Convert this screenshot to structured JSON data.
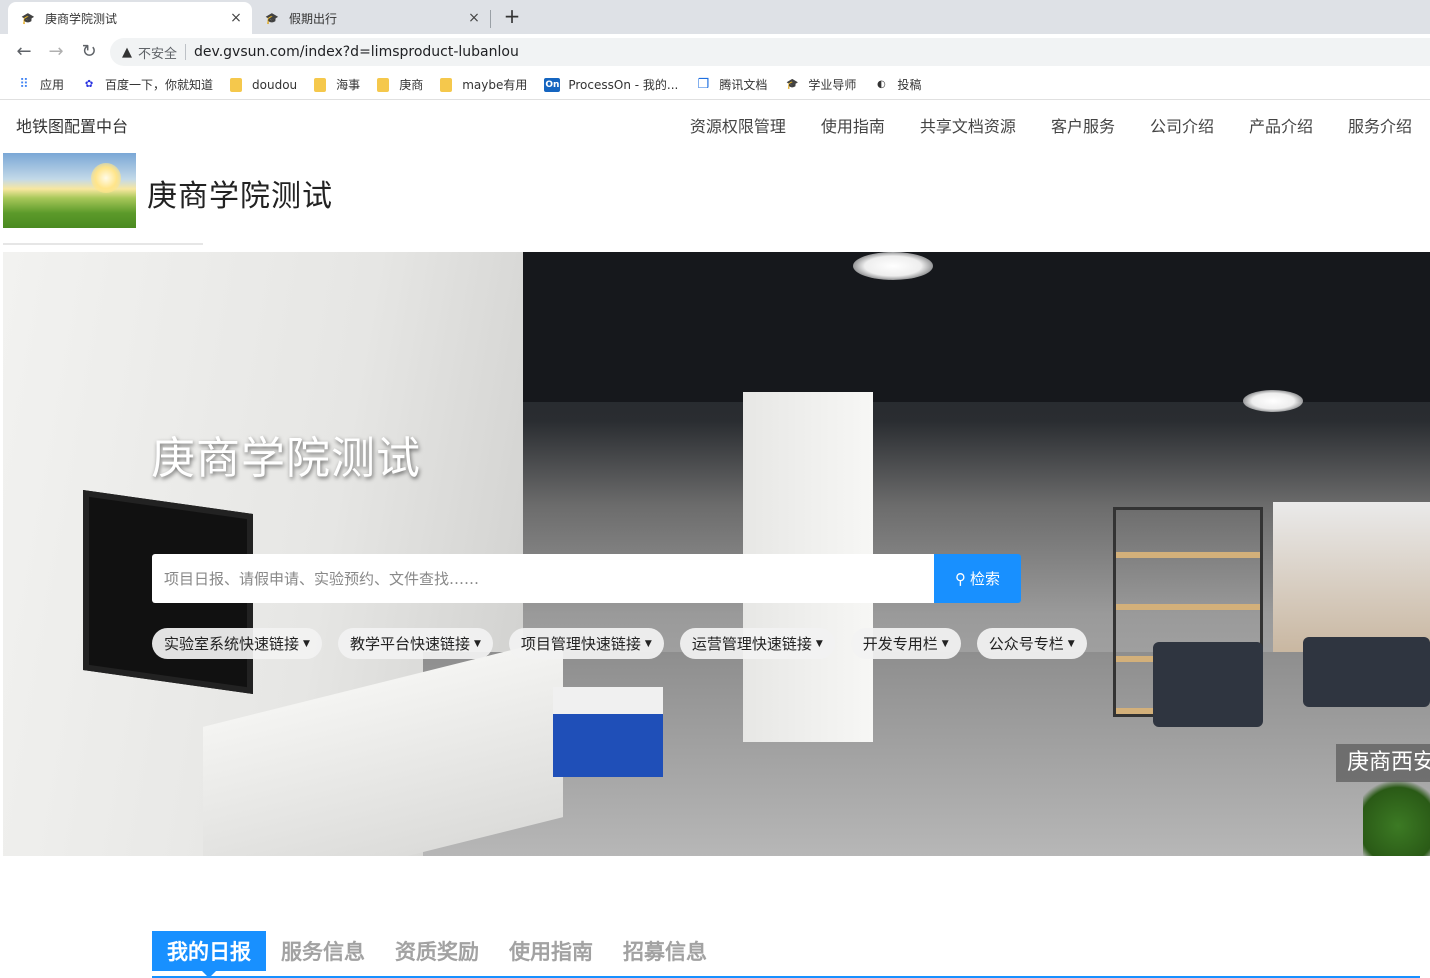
{
  "browser": {
    "tabs": [
      {
        "title": "庚商学院测试",
        "active": true,
        "icon": "graduation-cap-icon"
      },
      {
        "title": "假期出行",
        "active": false,
        "icon": "graduation-cap-icon"
      }
    ],
    "close_glyph": "×",
    "new_tab_glyph": "+",
    "security_label": "不安全",
    "url": "dev.gvsun.com/index?d=limsproduct-lubanlou",
    "bookmarks": [
      {
        "label": "应用",
        "icon": "apps-grid-icon"
      },
      {
        "label": "百度一下，你就知道",
        "icon": "baidu-paw-icon"
      },
      {
        "label": "doudou",
        "icon": "folder-icon"
      },
      {
        "label": "海事",
        "icon": "folder-icon"
      },
      {
        "label": "庚商",
        "icon": "folder-icon"
      },
      {
        "label": "maybe有用",
        "icon": "folder-icon"
      },
      {
        "label": "ProcessOn - 我的...",
        "icon": "processon-icon"
      },
      {
        "label": "腾讯文档",
        "icon": "tencent-docs-icon"
      },
      {
        "label": "学业导师",
        "icon": "graduation-cap-icon"
      },
      {
        "label": "投稿",
        "icon": "globe-icon"
      }
    ]
  },
  "site": {
    "brand": "地铁图配置中台",
    "nav": [
      "资源权限管理",
      "使用指南",
      "共享文档资源",
      "客户服务",
      "公司介绍",
      "产品介绍",
      "服务介绍"
    ],
    "logo_title": "庚商学院测试"
  },
  "hero": {
    "title": "庚商学院测试",
    "search_placeholder": "项目日报、请假申请、实验预约、文件查找……",
    "search_button": "检索",
    "quick_links": [
      "实验室系统快速链接",
      "教学平台快速链接",
      "项目管理快速链接",
      "运营管理快速链接",
      "开发专用栏",
      "公众号专栏"
    ],
    "caption": "庚商西安"
  },
  "info_tabs": [
    {
      "label": "我的日报",
      "active": true
    },
    {
      "label": "服务信息",
      "active": false
    },
    {
      "label": "资质奖励",
      "active": false
    },
    {
      "label": "使用指南",
      "active": false
    },
    {
      "label": "招募信息",
      "active": false
    }
  ],
  "colors": {
    "accent": "#1890ff",
    "tab_inactive": "#a2a2a2"
  }
}
